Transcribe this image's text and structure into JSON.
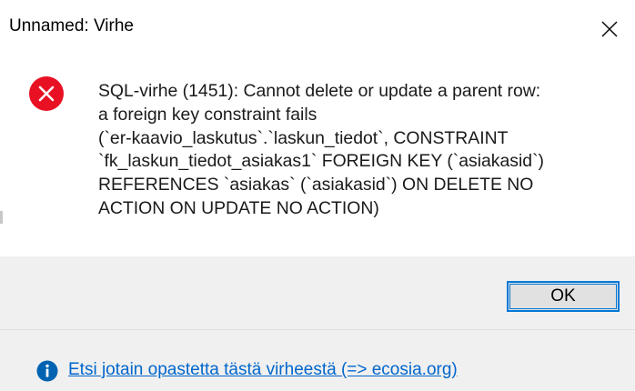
{
  "window": {
    "title": "Unnamed: Virhe"
  },
  "icons": {
    "close": "close-icon",
    "error": "error-circle-x-icon",
    "info": "info-circle-icon"
  },
  "message": {
    "lines": [
      "SQL-virhe (1451): Cannot delete or update a parent row:",
      "a foreign key constraint fails",
      "(`er-kaavio_laskutus`.`laskun_tiedot`, CONSTRAINT",
      "`fk_laskun_tiedot_asiakas1` FOREIGN KEY (`asiakasid`)",
      "REFERENCES `asiakas` (`asiakasid`) ON DELETE NO",
      "ACTION ON UPDATE NO ACTION)"
    ]
  },
  "buttons": {
    "ok_label": "OK"
  },
  "footer": {
    "help_link": "Etsi jotain opastetta tästä virheestä (=> ecosia.org)"
  },
  "colors": {
    "error_red": "#e81123",
    "info_blue": "#0063b1",
    "link_blue": "#0066cc",
    "focus_border": "#0078d7",
    "button_area_bg": "#f0f0f0"
  }
}
